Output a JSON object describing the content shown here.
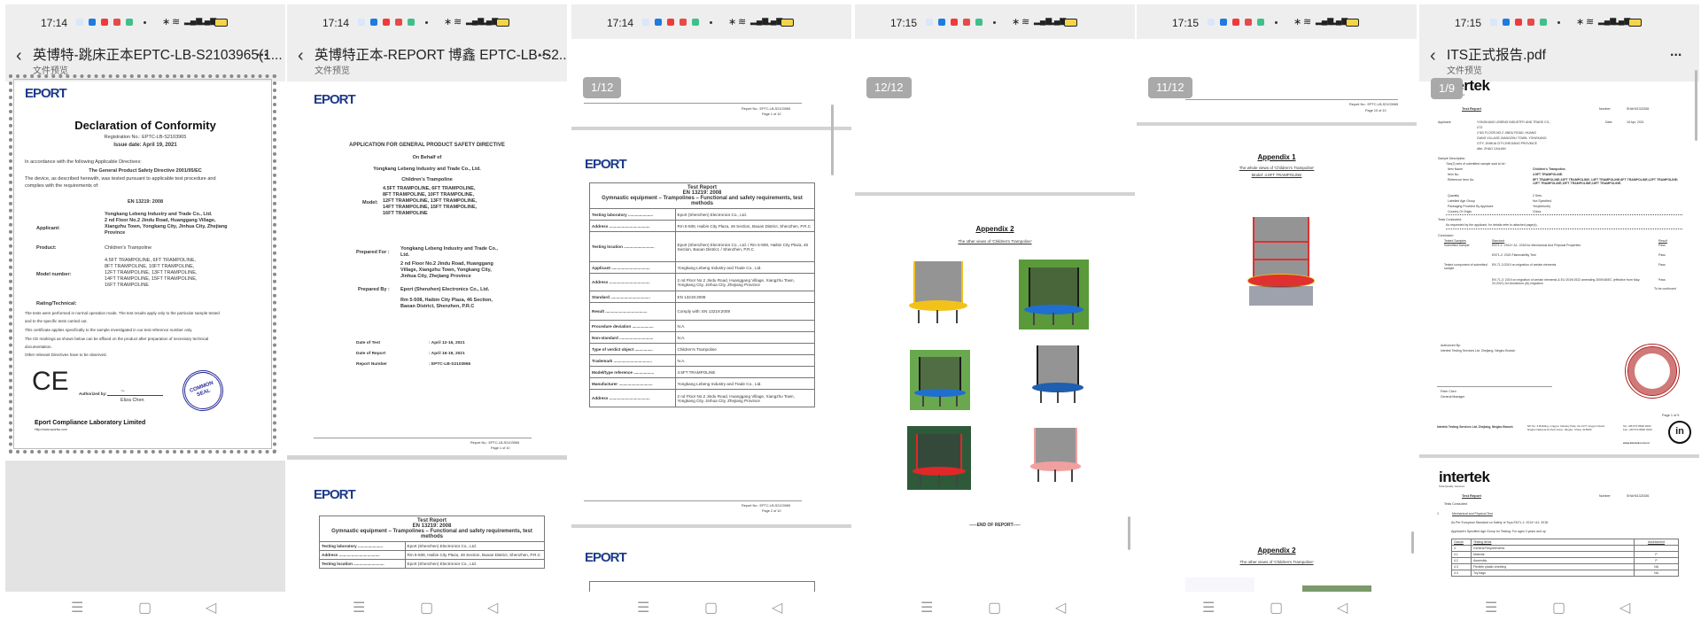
{
  "phones": [
    {
      "status_time": "17:14",
      "header": {
        "title": "英博特-跳床正本EPTC-LB-S2103965(1...",
        "subtitle": "文件预览"
      },
      "certificate": {
        "logo": "EPORT",
        "title": "Declaration of Conformity",
        "registration": "Registration No.: EPTC-LB-S2103965",
        "issue_date": "Issue date: April 19, 2021",
        "intro": "In accordance with the following Applicable Directives:",
        "directive": "The General Product Safety Directive 2001/95/EC",
        "device_text_1": "The device, as described herewith, was tested pursuant to applicable test procedure and",
        "device_text_2": "complies with the requirements of:",
        "standard": "EN 13219: 2008",
        "applicant_label": "Applicant:",
        "applicant_lines": [
          "Yongkang Lebeng Industry and Trade Co., Ltd.",
          "2 nd Floor No.2 Jindu Road, Huanggang Village,",
          "Xiangzhu Town, Yongkang City, Jinhua City, Zhejiang",
          "Province"
        ],
        "product_label": "Product:",
        "product": "Children's Trampoline",
        "model_label": "Model number:",
        "model_lines": [
          "4.5FT TRAMPOLINE, 6FT TRAMPOLINE,",
          "8FT TRAMPOLINE, 10FT TRAMPOLINE,",
          "12FT TRAMPOLINE, 13FT TRAMPOLINE,",
          "14FT TRAMPOLINE, 15FT TRAMPOLINE,",
          "16FT TRAMPOLINE"
        ],
        "rating_label": "Rating/Technical:",
        "notes": [
          "The tests were performed in normal operation mode. The test results apply only to the particular sample tested",
          "and to the specific tests carried out.",
          "This certificate applies specifically to the sample investigated in our test reference number only.",
          "The CE markings as shown below can be affixed on the product after preparation of necessary technical",
          "documentation.",
          "Other relevant Directives have to be observed."
        ],
        "ce_mark": "CE",
        "authorized_by": "Authorized by:",
        "signatory": "Eliza Chen",
        "seal_text": "COMMON SEAL",
        "company": "Eport Compliance Laboratory Limited",
        "url": "Http://www.eportsz.com"
      }
    },
    {
      "status_time": "17:14",
      "header": {
        "title": "英博特正本-REPORT 博鑫 EPTC-LB-S2...",
        "subtitle": "文件预览"
      },
      "cover": {
        "logo": "EPORT",
        "heading": "APPLICATION FOR GENERAL PRODUCT SAFETY DIRECTIVE",
        "on_behalf": "On Behalf of",
        "company": "Yongkang Lebeng Industry and Trade Co., Ltd.",
        "product": "Children's Trampoline",
        "model_label": "Model:",
        "model_lines": [
          "4.5FT TRAMPOLINE, 6FT TRAMPOLINE,",
          "8FT TRAMPOLINE, 10FT TRAMPOLINE,",
          "12FT TRAMPOLINE, 13FT TRAMPOLINE,",
          "14FT TRAMPOLINE, 15FT TRAMPOLINE,",
          "16FT TRAMPOLINE"
        ],
        "prepared_for_label": "Prepared For :",
        "prepared_for_lines": [
          "Yongkang Lebeng Industry and Trade Co.,",
          "Ltd.",
          "2 nd Floor No.2 Jindu Road, Huanggang",
          "Village, Xiangzhu Town, Yongkang City,",
          "Jinhua City, Zhejiang Province"
        ],
        "prepared_by_label": "Prepared By :",
        "prepared_by_lines": [
          "Eport (Shenzhen) Electronics Co., Ltd.",
          "Rm 5-508, Haibin City Plaza, 46 Section,",
          "Baoan District, Shenzhen, P.R.C"
        ],
        "dates": [
          {
            "label": "Date of Test",
            "value": ":   April 12-16, 2021"
          },
          {
            "label": "Date of Report",
            "value": ":   April 16-19, 2021"
          },
          {
            "label": "Report Number",
            "value": ":   EPTC-LB-S2103965"
          }
        ],
        "footer_report": "Report No.: EPTC-LB-S2103965",
        "footer_page": "Page 1 of 10"
      },
      "page2": {
        "logo": "EPORT",
        "head": [
          "Test Report",
          "EN 13219: 2008",
          "Gymnastic equipment – Trampolines – Functional and safety requirements, test methods"
        ],
        "rows": [
          {
            "k": "Testing laboratory ......................",
            "v": "Eport (Shenzhen) Electronics Co., Ltd."
          },
          {
            "k": "Address ....................................",
            "v": "Rm 5-508, Haibin City Plaza, 46 Section, Baoan District, Shenzhen, P.R.C"
          },
          {
            "k": "Testing location ...........................",
            "v": "Eport (Shenzhen) Electronics Co., Ltd."
          }
        ]
      }
    },
    {
      "status_time": "17:14",
      "page_badge": "1/12",
      "top_footer": {
        "report": "Report No.: EPTC-LB-S2103965",
        "page": "Page 1 of 10"
      },
      "report": {
        "logo": "EPORT",
        "head": [
          "Test Report",
          "EN 13219: 2008",
          "Gymnastic equipment – Trampolines – Functional and safety requirements, test methods"
        ],
        "rows": [
          {
            "k": "Testing laboratory ......................",
            "v": "Eport (Shenzhen) Electronics Co., Ltd."
          },
          {
            "k": "Address ....................................",
            "v": "Rm 5-508, Haibin City Plaza, 46 Section, Baoan District, Shenzhen, P.R.C"
          },
          {
            "k": "Testing location ...........................",
            "v": "Eport (Shenzhen) Electronics Co., Ltd. / Rm 5-508, Haibin City Plaza, 46 Section, Baoan District, / Shenzhen, P.R.C"
          },
          {
            "k": "Applicant ..................................",
            "v": "Yongkang Lebeng Industry and Trade Co., Ltd."
          },
          {
            "k": "Address ....................................",
            "v": "2 nd Floor No.2 Jindu Road, Huanggang Village, Xiangzhu Town, Yongkang City, Jinhua City, Zhejiang Province"
          },
          {
            "k": "Standard ...................................",
            "v": "EN 13219:2008"
          },
          {
            "k": "Result .....................................",
            "v": "Comply with: EN 13219:2008"
          },
          {
            "k": "Procedure deviation ...................",
            "v": "N.A."
          },
          {
            "k": "Non-standard ..............................",
            "v": "N.A."
          },
          {
            "k": "Type of verdict object ................",
            "v": "Children's Trampoline"
          },
          {
            "k": "Trademark ..................................",
            "v": "N.A."
          },
          {
            "k": "Model/type reference ..................",
            "v": "4.5FT TRAMPOLINE"
          },
          {
            "k": "Manufacturer ..............................",
            "v": "Yongkang Lebeng Industry and Trade Co., Ltd."
          },
          {
            "k": "Address ....................................",
            "v": "2 nd Floor No.2 Jindu Road, Huanggang Village, Xiangzhu Town, Yongkang City, Jinhua City, Zhejiang Province"
          }
        ],
        "footer_report": "Report No.: EPTC-LB-S2103965",
        "footer_page": "Page 2 of 10",
        "next_logo": "EPORT"
      }
    },
    {
      "status_time": "17:15",
      "page_badge": "12/12",
      "appendix": {
        "title": "Appendix 2",
        "subtitle": "The other views of 'Children's Trampoline'"
      },
      "images": [
        {
          "frame": "#f2c21b",
          "mat": "#f2c21b",
          "bg": "#ffffff"
        },
        {
          "frame": "#1b1b1b",
          "mat": "#1f6fd0",
          "bg": "#5a9a3a"
        },
        {
          "frame": "#1b1b1b",
          "mat": "#1f6fd0",
          "bg": "#6aa84f"
        },
        {
          "frame": "#1b1b1b",
          "mat": "#1f5fb0",
          "bg": "#ffffff"
        },
        {
          "frame": "#e02828",
          "mat": "#e02828",
          "bg": "#2e5a3a"
        },
        {
          "frame": "#f1a0a0",
          "mat": "#f1a0a0",
          "bg": "#ffffff"
        }
      ],
      "end": "-----END OF REPORT-----"
    },
    {
      "status_time": "17:15",
      "page_badge": "11/12",
      "top_footer": {
        "report": "Report No.: EPTC-LB-S2103965",
        "page": "Page 10 of 10"
      },
      "appendix1": {
        "title": "Appendix 1",
        "subtitle": "The whole views of 'Children's Trampoline'",
        "model": "Model: 4.5FT TRAMPOLINE"
      },
      "appendix2": {
        "title": "Appendix 2",
        "subtitle": "The other views of 'Children's Trampoline'"
      }
    },
    {
      "status_time": "17:15",
      "header": {
        "title": "ITS正式报告.pdf",
        "subtitle": "文件预览"
      },
      "page_badge": "1/9",
      "its": {
        "logo": "intertek",
        "tagline": "Total Quality. Assured.",
        "test_report": "Test Report",
        "number_label": "Number:",
        "number": "SHAH01323336",
        "applicant_label": "Applicant:",
        "applicant_lines": [
          "YONGKANG LEBENG INDUSTRY AND TRADE CO.,",
          "LTD",
          "2 ND FLOOR,NO.2 JINDU ROAD, HUANG",
          "GANG VILLAGE,XIANGZHU TOWN, YONGKANG",
          "CITY, JINHUA CITY,ZHEJIANG PROVINCE",
          "Attn:        ZHAO CAILIAN"
        ],
        "date_label": "Date:",
        "date": "16 Apr, 2021",
        "sample_label": "Sample Description:",
        "sample_intro": "Two(2) sets of submitted sample said to be :",
        "sample_rows": [
          {
            "k": "Item Name",
            "v": "Children's Trampoline."
          },
          {
            "k": "Item No.",
            "v": "4.5FT TRAMPOLINE."
          },
          {
            "k": "Reference Item No.",
            "v": "8FT TRAMPOLINE;10FT TRAMPOLINE; 14FT TRAMPOLINE;6FT TRAMPOLINE;12FT TRAMPOLINE; 13FT TRAMPOLINE;15FT TRAMPOLINE;16FT TRAMPOLINE."
          },
          {
            "k": "Quantity",
            "v": "2 Sets."
          },
          {
            "k": "Labelled Age Group",
            "v": "Not Specified."
          },
          {
            "k": "Packaging Provided By Applicant",
            "v": "Yes(Artwork)."
          },
          {
            "k": "Country Of Origin",
            "v": "China."
          }
        ],
        "tests_label": "Tests Conducted:",
        "tests_text": "As requested by the applicant, for details refer to attached page(s).",
        "conclusion_label": "Conclusion:",
        "conclusion_head": {
          "sample": "Tested Samples",
          "standard": "Standard",
          "result": "Result"
        },
        "conclusion_rows": [
          {
            "sample": "Submitted Sample",
            "standard": "EN71-1: 2014+ A1: 2018 for Mechanical And Physical Properties",
            "result": "Pass"
          },
          {
            "sample": "",
            "standard": "EN71-2: 2020 Flammability Test",
            "result": "Pass"
          },
          {
            "sample": "Tested component of submitted sample",
            "standard": "EN 71-3:2019 on migration of certain elements",
            "result": "Pass"
          },
          {
            "sample": "",
            "standard": "EN 71-3: 2019 on migration of certain elements & EU 2019/1922 amending 2009/48/EC (effective from May. 20,2021) for Aluminium (Al) migration",
            "result": "Pass"
          }
        ],
        "continued": "To be continued",
        "authorized_label": "Authorized By:",
        "authorized_org": "Intertek Testing Services Ltd. Zhejiang, Ningbo Branch",
        "signer": "Peter Chen",
        "signer_title": "General Manager",
        "page": "Page 1 of 9",
        "footer_company": "Intertek Testing Services Ltd. Zhejiang, Ningbo Branch",
        "footer_address": "5/F No. 6 Building, Lingyun Industry Park, No.1177 Lingyun Road, Ningbo National Hi-Tech Zone, Ningbo, China, 315000",
        "footer_tel": "Tel: +86 574 8818 3000  Fax: +86 574 8818 3000",
        "footer_web": "www.intertek.com.cn",
        "page2": {
          "logo": "intertek",
          "tagline": "Total Quality. Assured.",
          "test_report": "Test Report",
          "number_label": "Number:",
          "number": "SHAH01323336",
          "tests_conducted": "Tests Conducted",
          "section_no": "1",
          "section": "Mechanical and Physical Test",
          "standard_line": "As Per European Standard on Safety of Toys EN71-1: 2014+ A1: 2018.",
          "age_line": "Applicant's Specified Age Group for Testing: For ages 3 years and up",
          "table_head": {
            "clause": "Clause",
            "item": "Testing items",
            "assessment": "Assessment"
          },
          "table_rows": [
            {
              "clause": "4",
              "item": "General Requirements",
              "assessment": ""
            },
            {
              "clause": "4.1",
              "item": "Material",
              "assessment": "P"
            },
            {
              "clause": "4.2",
              "item": "Assembly",
              "assessment": "P"
            },
            {
              "clause": "4.3",
              "item": "Flexible plastic sheeting",
              "assessment": "NA"
            },
            {
              "clause": "4.4",
              "item": "Toy bags",
              "assessment": "NA"
            }
          ]
        }
      }
    }
  ],
  "nav": {
    "menu_icon": "☰",
    "home_icon": "▢",
    "back_icon": "◁"
  },
  "common": {
    "back_icon": "‹",
    "more_icon": "..."
  }
}
